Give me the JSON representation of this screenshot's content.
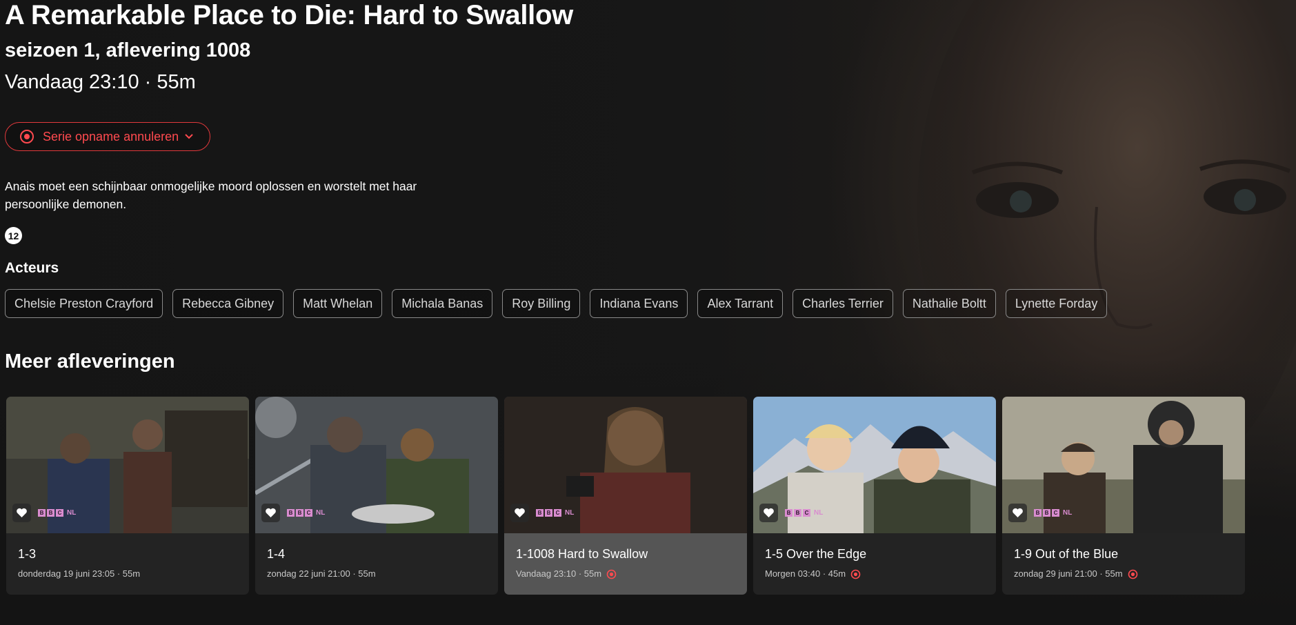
{
  "program": {
    "title": "A Remarkable Place to Die: Hard to Swallow",
    "episode_label": "seizoen 1, aflevering 1008",
    "airtime": "Vandaag 23:10 · 55m",
    "record_button_label": "Serie opname annuleren",
    "description": "Anais moet een schijnbaar onmogelijke moord oplossen en worstelt met haar persoonlijke demonen.",
    "age_rating": "12"
  },
  "actors": {
    "heading": "Acteurs",
    "names": [
      "Chelsie Preston Crayford",
      "Rebecca Gibney",
      "Matt Whelan",
      "Michala Banas",
      "Roy Billing",
      "Indiana Evans",
      "Alex Tarrant",
      "Charles Terrier",
      "Nathalie Boltt",
      "Lynette Forday"
    ]
  },
  "more_episodes": {
    "heading": "Meer afleveringen",
    "channel": "BBC NL",
    "channel_letters": [
      "B",
      "B",
      "C"
    ],
    "channel_suffix": "NL",
    "items": [
      {
        "title": "1-3",
        "meta": "donderdag 19 juni 23:05 · 55m",
        "recording": false,
        "active": false
      },
      {
        "title": "1-4",
        "meta": "zondag 22 juni 21:00 · 55m",
        "recording": false,
        "active": false
      },
      {
        "title": "1-1008 Hard to Swallow",
        "meta": "Vandaag 23:10 · 55m",
        "recording": true,
        "active": true
      },
      {
        "title": "1-5 Over the Edge",
        "meta": "Morgen 03:40 · 45m",
        "recording": true,
        "active": false
      },
      {
        "title": "1-9 Out of the Blue",
        "meta": "zondag 29 juni 21:00 · 55m",
        "recording": true,
        "active": false
      }
    ]
  },
  "colors": {
    "background": "#141414",
    "record_accent": "#e2393c",
    "channel_pink": "#d98ccf"
  }
}
